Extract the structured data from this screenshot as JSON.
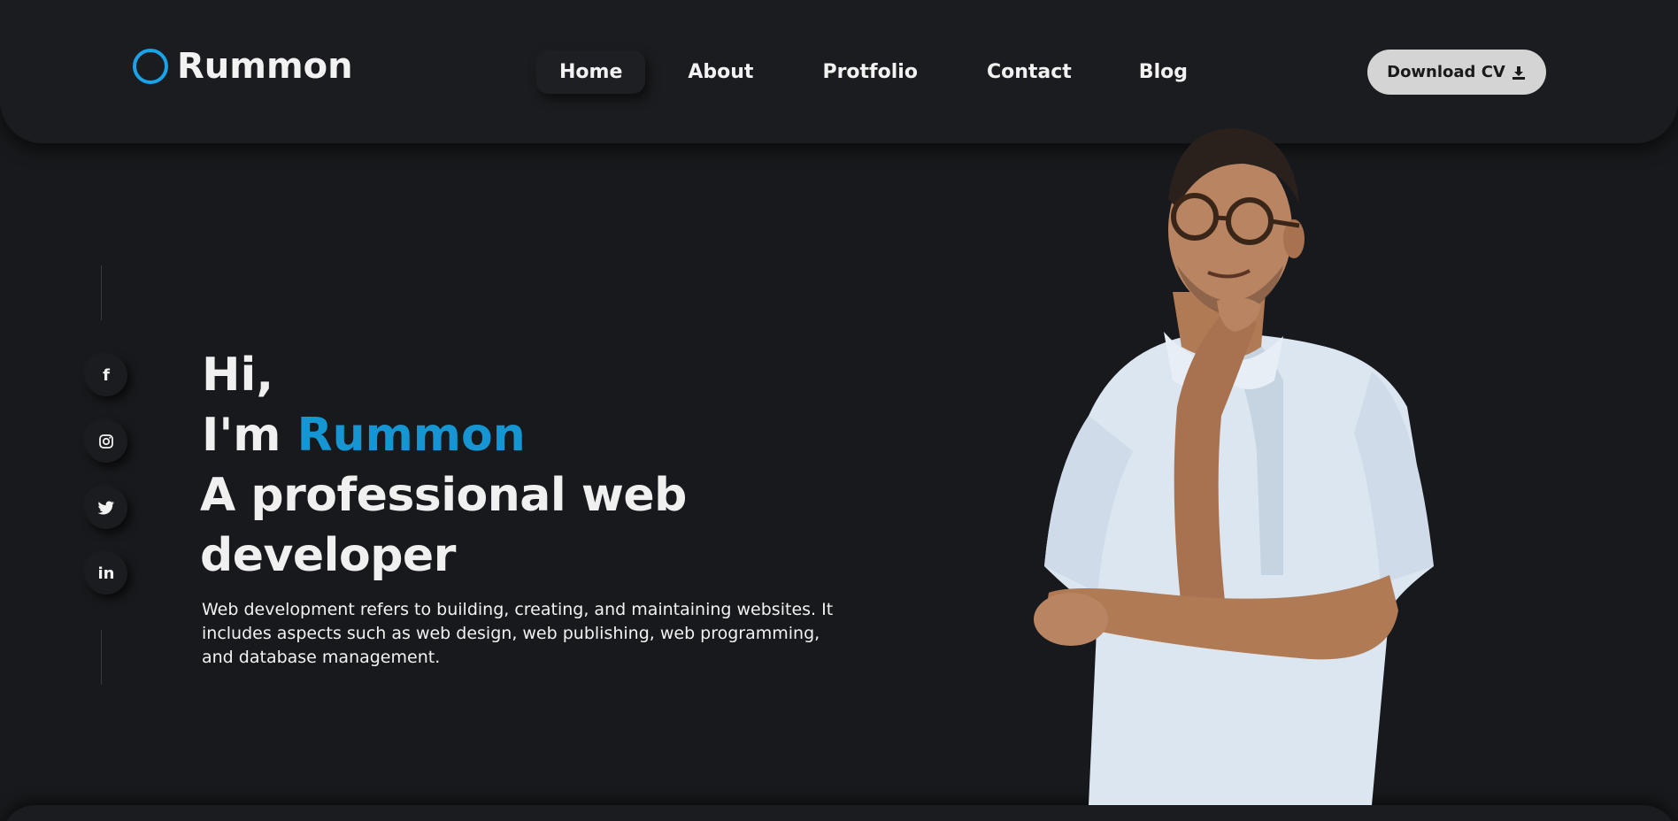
{
  "brand": {
    "name": "Rummon",
    "accent_color": "#1aa3e8"
  },
  "nav": {
    "items": [
      {
        "label": "Home",
        "active": true
      },
      {
        "label": "About",
        "active": false
      },
      {
        "label": "Protfolio",
        "active": false
      },
      {
        "label": "Contact",
        "active": false
      },
      {
        "label": "Blog",
        "active": false
      }
    ]
  },
  "header": {
    "cv_button_label": "Download CV",
    "cv_icon": "download-icon"
  },
  "social": {
    "items": [
      {
        "icon": "facebook-icon",
        "glyph": "f"
      },
      {
        "icon": "instagram-icon",
        "glyph": ""
      },
      {
        "icon": "twitter-icon",
        "glyph": ""
      },
      {
        "icon": "linkedin-icon",
        "glyph": "in"
      }
    ]
  },
  "hero": {
    "greeting": "Hi,",
    "intro_prefix": "I'm ",
    "intro_name": "Rummon",
    "role": "A professional web developer",
    "description": "Web development refers to building, creating, and maintaining websites. It includes aspects such as web design, web publishing, web programming, and database management.",
    "name_color": "#1596d3"
  },
  "colors": {
    "background": "#18191c",
    "panel": "#1b1c1f",
    "button_bg": "#d4d4d4"
  }
}
